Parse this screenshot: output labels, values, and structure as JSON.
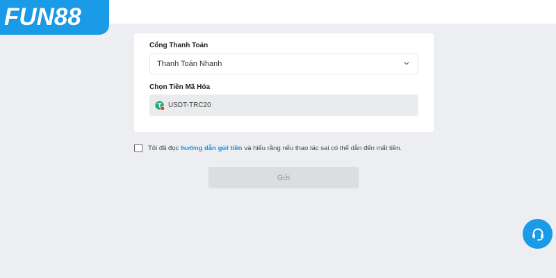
{
  "brand": {
    "logo_text": "FUN88",
    "accent_color": "#1a9be8"
  },
  "form": {
    "gateway": {
      "label": "Cổng Thanh Toán",
      "value": "Thanh Toán Nhanh"
    },
    "coin": {
      "label": "Chọn Tiền Mã Hóa",
      "value": "USDT-TRC20",
      "icon": "tether-coin-icon"
    }
  },
  "agreement": {
    "text_before": "Tôi đã đọc",
    "link_text": "hướng dẫn gửi tiền",
    "text_after": "và hiểu rằng nếu thao tác sai có thể dẫn đến mất tiền."
  },
  "submit_label": "Gửi",
  "support_icon": "headset-icon"
}
